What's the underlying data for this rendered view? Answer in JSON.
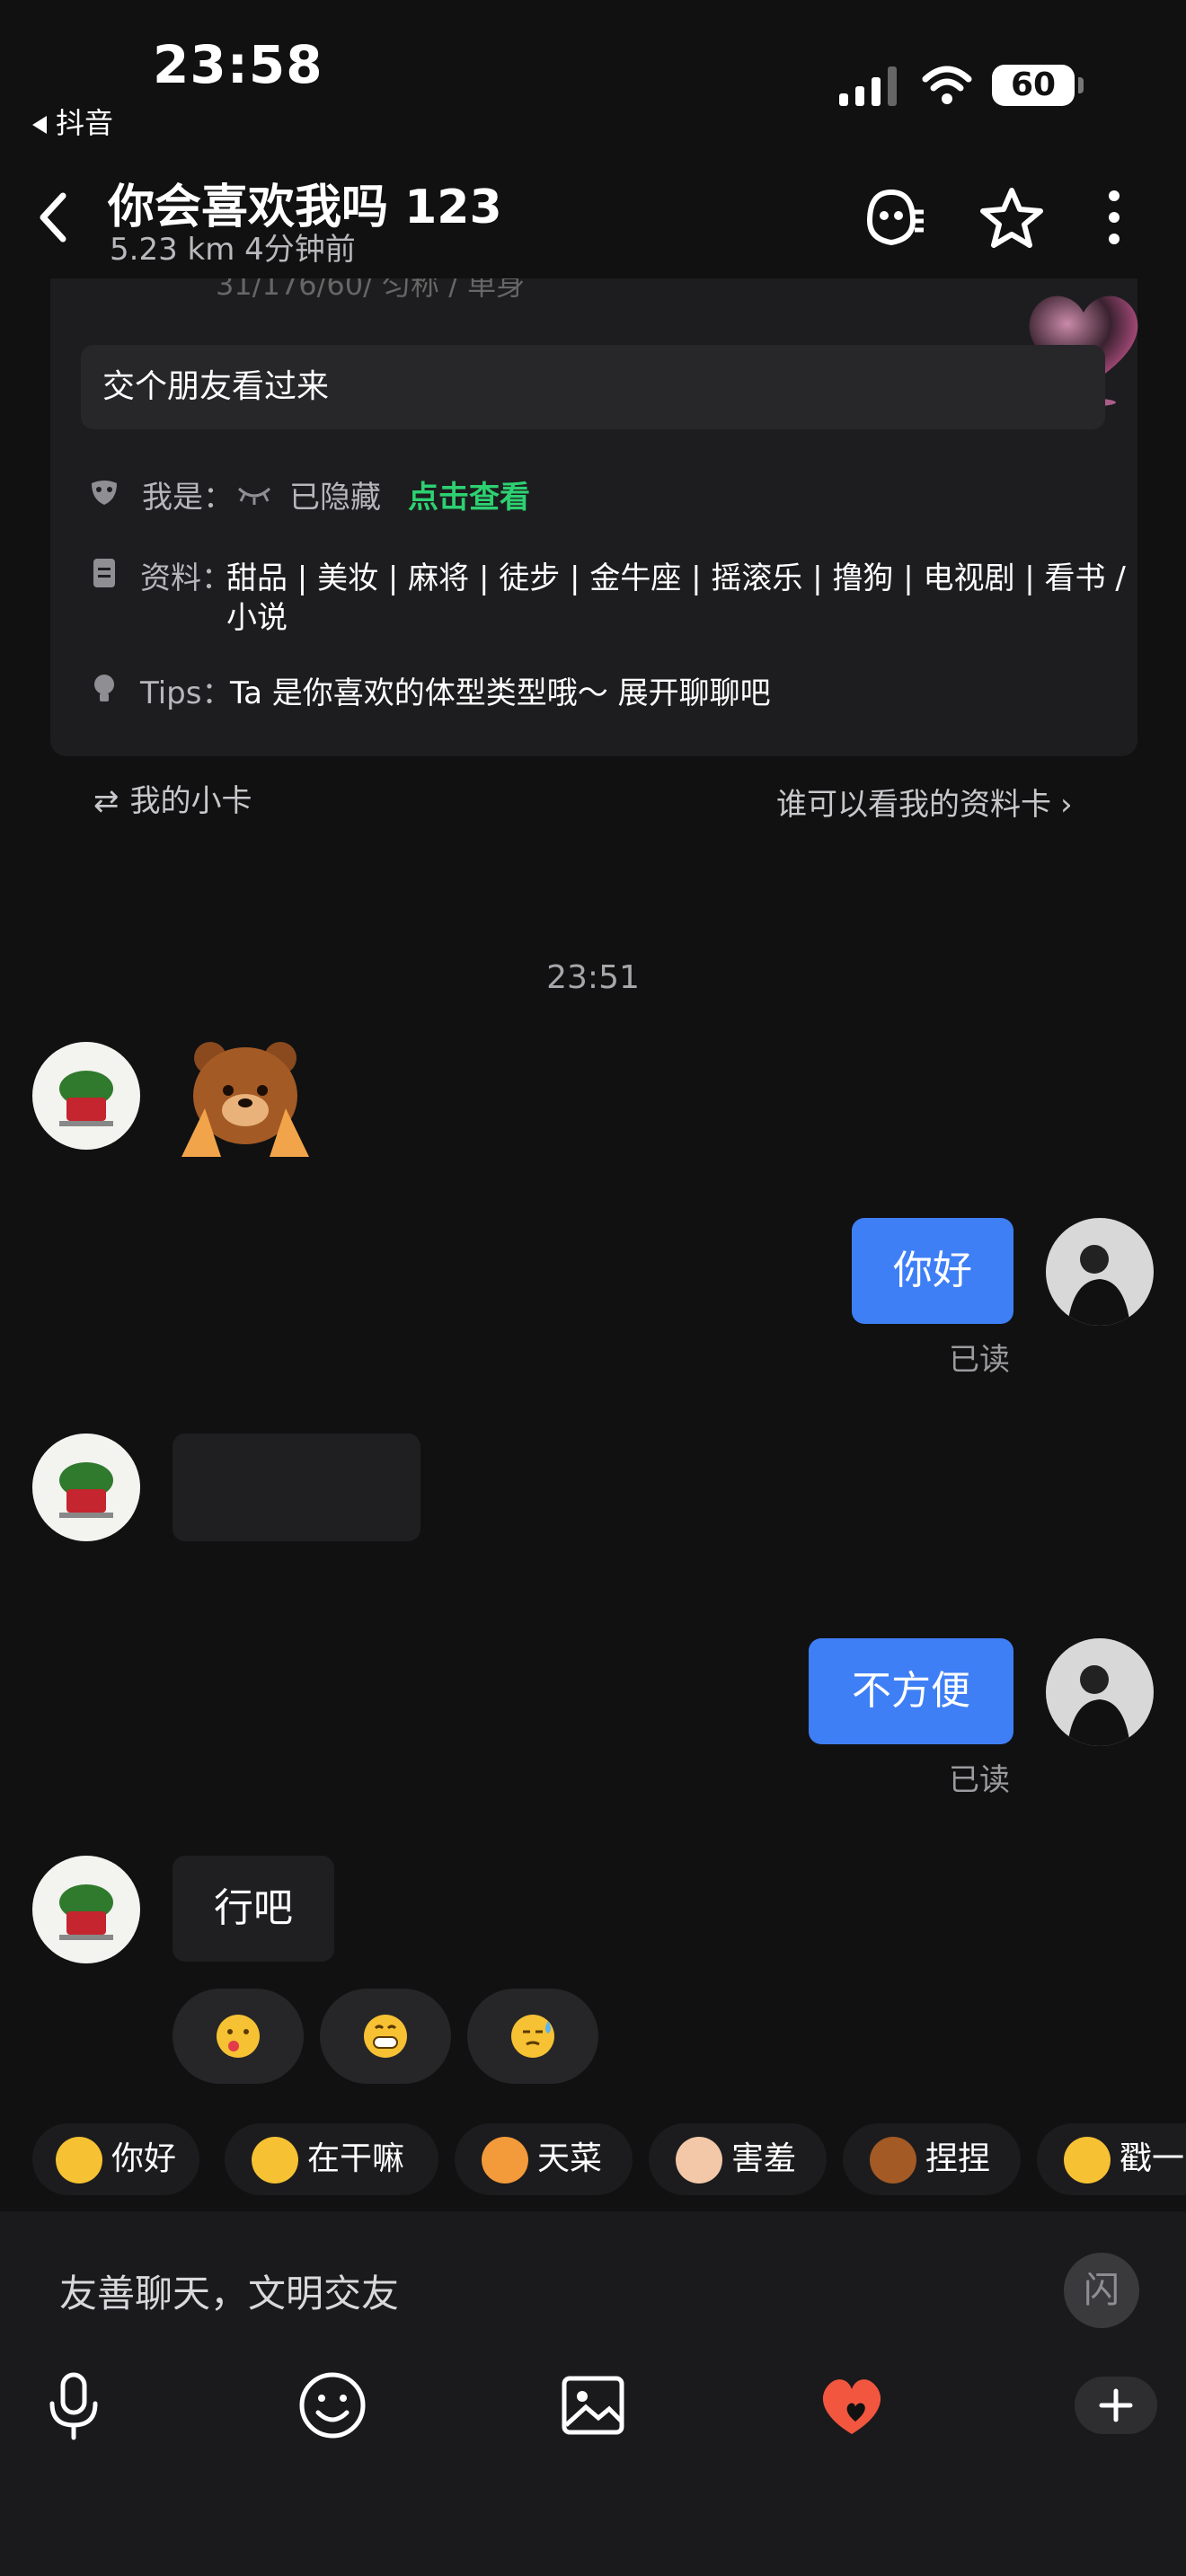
{
  "status_bar": {
    "time": "23:58",
    "back_app": "抖音",
    "battery": "60"
  },
  "header": {
    "title": "你会喜欢我吗 123",
    "subtitle": "5.23 km  4分钟前",
    "icons": [
      "ghost-icon",
      "star-icon",
      "more-vertical-icon"
    ]
  },
  "profile_card": {
    "partial_line": "31/176/60/ 匀称 / 单身",
    "greeting": "交个朋友看过来",
    "iam_label": "我是：",
    "iam_value": "已隐藏",
    "iam_action": "点击查看",
    "info_label": "资料：",
    "info_value_line1": "甜品 | 美妆 | 麻将 | 徒步 | 金牛座 | 摇滚乐 | 撸狗 | 电视剧 | 看书 /",
    "info_value_line2": "小说",
    "tips_label": "Tips：",
    "tips_value": "Ta 是你喜欢的体型类型哦～ 展开聊聊吧"
  },
  "card_footer": {
    "my_card": "我的小卡",
    "who_can_see": "谁可以看我的资料卡"
  },
  "chat": {
    "timestamp": "23:51",
    "messages": [
      {
        "side": "in",
        "type": "sticker",
        "sticker": "bear-sticker"
      },
      {
        "side": "out",
        "text": "你好",
        "status": "已读"
      },
      {
        "side": "in",
        "type": "blank"
      },
      {
        "side": "out",
        "text": "不方便",
        "status": "已读"
      },
      {
        "side": "in",
        "text": "行吧"
      }
    ],
    "reaction_emojis": [
      "kiss-emoji",
      "grin-emoji",
      "sweat-emoji"
    ]
  },
  "quick_replies": [
    {
      "label": "你好",
      "icon": "hi-emoji"
    },
    {
      "label": "在干嘛",
      "icon": "thinking-emoji"
    },
    {
      "label": "天菜",
      "icon": "cat-emoji"
    },
    {
      "label": "害羞",
      "icon": "shy-emoji"
    },
    {
      "label": "捏捏",
      "icon": "bear-emoji"
    },
    {
      "label": "戳一",
      "icon": "point-emoji"
    }
  ],
  "input": {
    "placeholder": "友善聊天，文明交友",
    "flash_label": "闪"
  },
  "colors": {
    "accent_blue": "#3f7ff6",
    "green": "#2dd171",
    "background": "#111112"
  }
}
